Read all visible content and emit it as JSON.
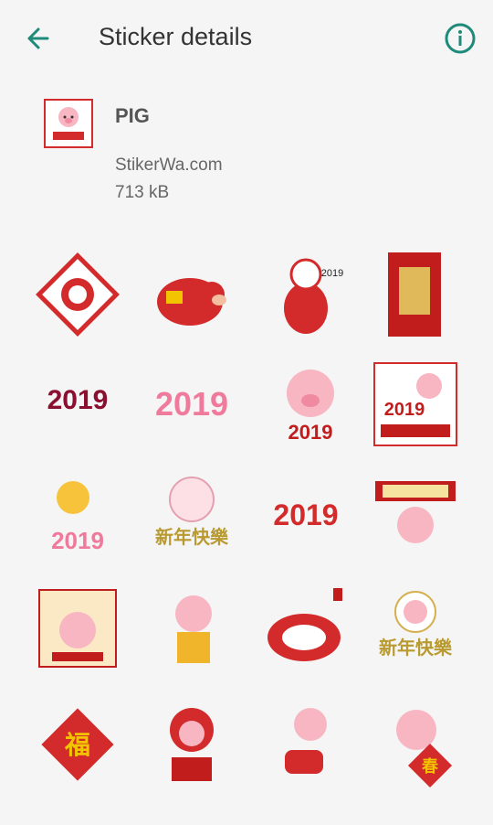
{
  "appbar": {
    "title": "Sticker details",
    "back_icon": "arrow-back-icon",
    "info_icon": "info-icon",
    "accent": "#1e8a7a"
  },
  "pack": {
    "name": "PIG",
    "publisher": "StikerWa.com",
    "size": "713 kB"
  },
  "stickers": [
    {
      "text": ""
    },
    {
      "text": ""
    },
    {
      "text": "2019"
    },
    {
      "text": ""
    },
    {
      "text": "2019"
    },
    {
      "text": "2019"
    },
    {
      "text": "2019"
    },
    {
      "text": "2019"
    },
    {
      "text": "2019"
    },
    {
      "text": "新年快樂"
    },
    {
      "text": "2019"
    },
    {
      "text": ""
    },
    {
      "text": ""
    },
    {
      "text": ""
    },
    {
      "text": ""
    },
    {
      "text": "新年快樂"
    },
    {
      "text": "福"
    },
    {
      "text": ""
    },
    {
      "text": ""
    },
    {
      "text": "春"
    },
    {
      "text": ""
    },
    {
      "text": ""
    },
    {
      "text": ""
    },
    {
      "text": ""
    }
  ]
}
